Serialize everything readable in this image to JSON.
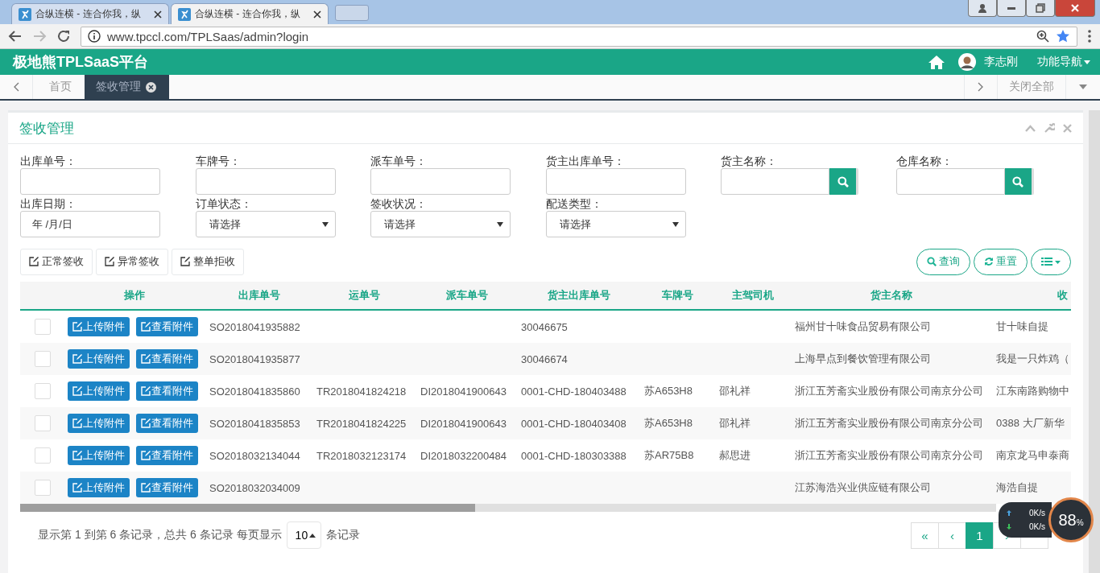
{
  "browser": {
    "tabs": [
      {
        "title": "合纵连横 - 连合你我，纵",
        "selected": false
      },
      {
        "title": "合纵连横 - 连合你我，纵",
        "selected": true
      }
    ],
    "url": "www.tpccl.com/TPLSaas/admin?login"
  },
  "header": {
    "title": "极地熊TPLSaaS平台",
    "user": "李志刚",
    "menu": "功能导航"
  },
  "tabs": [
    {
      "label": "首页",
      "selected": false,
      "closable": false
    },
    {
      "label": "签收管理",
      "selected": true,
      "closable": true
    }
  ],
  "close_all": "关闭全部",
  "panel": {
    "title": "签收管理"
  },
  "filters": [
    {
      "label": "出库单号：",
      "kind": "text"
    },
    {
      "label": "车牌号：",
      "kind": "text"
    },
    {
      "label": "派车单号：",
      "kind": "text"
    },
    {
      "label": "货主出库单号：",
      "kind": "text"
    },
    {
      "label": "货主名称：",
      "kind": "search"
    },
    {
      "label": "仓库名称：",
      "kind": "search"
    },
    {
      "label": "出库日期：",
      "kind": "date",
      "value": "年 /月/日"
    },
    {
      "label": "订单状态：",
      "kind": "select",
      "value": "请选择"
    },
    {
      "label": "签收状况：",
      "kind": "select",
      "value": "请选择"
    },
    {
      "label": "配送类型：",
      "kind": "select",
      "value": "请选择"
    }
  ],
  "actions": [
    "正常签收",
    "异常签收",
    "整单拒收"
  ],
  "tools": [
    {
      "label": "查询",
      "kind": "search"
    },
    {
      "label": "重置",
      "kind": "refresh"
    },
    {
      "kind": "columns"
    }
  ],
  "table": {
    "columns": [
      "操作",
      "出库单号",
      "运单号",
      "派车单号",
      "货主出库单号",
      "车牌号",
      "主驾司机",
      "货主名称",
      "收"
    ],
    "rows": [
      {
        "checked": false,
        "upload": "上传附件",
        "view": "查看附件",
        "cells": [
          "",
          "SO2018041935882",
          "",
          "",
          "30046675",
          "",
          "",
          "福州甘十味食品贸易有限公司",
          "甘十味自提"
        ]
      },
      {
        "checked": false,
        "upload": "上传附件",
        "view": "查看附件",
        "cells": [
          "",
          "SO2018041935877",
          "",
          "",
          "30046674",
          "",
          "",
          "上海早点到餐饮管理有限公司",
          "我是一只炸鸡（"
        ]
      },
      {
        "checked": false,
        "upload": "上传附件",
        "view": "查看附件",
        "cells": [
          "",
          "SO2018041835860",
          "TR2018041824218",
          "DI2018041900643",
          "0001-CHD-180403488",
          "苏A653H8",
          "邵礼祥",
          "浙江五芳斋实业股份有限公司南京分公司",
          "江东南路购物中"
        ]
      },
      {
        "checked": false,
        "upload": "上传附件",
        "view": "查看附件",
        "cells": [
          "",
          "SO2018041835853",
          "TR2018041824225",
          "DI2018041900643",
          "0001-CHD-180403408",
          "苏A653H8",
          "邵礼祥",
          "浙江五芳斋实业股份有限公司南京分公司",
          "0388 大厂新华"
        ]
      },
      {
        "checked": false,
        "upload": "上传附件",
        "view": "查看附件",
        "cells": [
          "",
          "SO2018032134044",
          "TR2018032123174",
          "DI2018032200484",
          "0001-CHD-180303388",
          "苏AR75B8",
          "郝思进",
          "浙江五芳斋实业股份有限公司南京分公司",
          "南京龙马申泰商"
        ]
      },
      {
        "checked": false,
        "upload": "上传附件",
        "view": "查看附件",
        "cells": [
          "",
          "SO2018032034009",
          "",
          "",
          "",
          "",
          "",
          "江苏海浩兴业供应链有限公司",
          "海浩自提"
        ]
      }
    ]
  },
  "footer": {
    "summary": "显示第 1 到第 6 条记录，总共 6 条记录 每页显示",
    "page_size": "10",
    "suffix": "条记录"
  },
  "pagination": [
    {
      "label": "«",
      "selected": false
    },
    {
      "label": "‹",
      "selected": false
    },
    {
      "label": "1",
      "selected": true
    },
    {
      "label": "›",
      "selected": false
    },
    {
      "selected": false
    }
  ],
  "widget": {
    "up": "0K/s",
    "down": "0K/s",
    "percent": "88",
    "unit": "%"
  }
}
